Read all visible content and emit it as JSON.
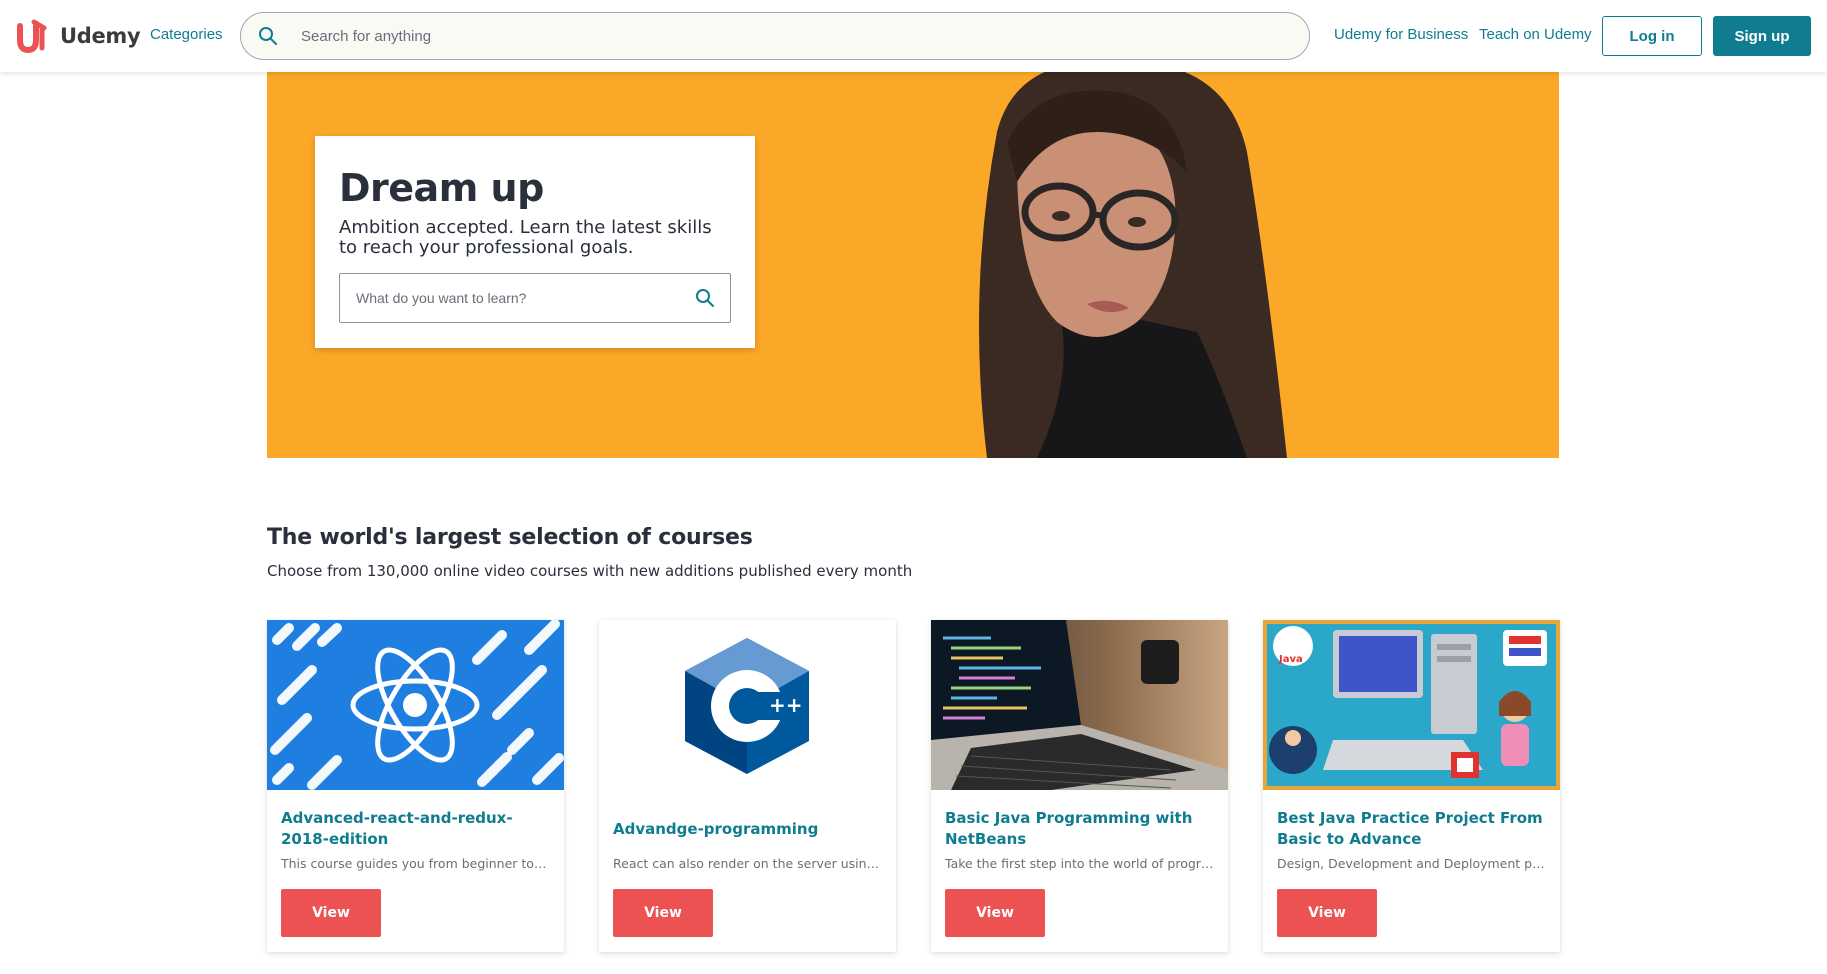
{
  "header": {
    "logo_text": "Udemy",
    "categories_label": "Categories",
    "search_placeholder": "Search for anything",
    "business_label": "Udemy for Business",
    "teach_label": "Teach on Udemy",
    "login_label": "Log in",
    "signup_label": "Sign up"
  },
  "hero": {
    "title": "Dream up",
    "subtitle": "Ambition accepted. Learn the latest skills to reach your professional goals.",
    "search_placeholder": "What do you want to learn?",
    "background_color": "#fba728"
  },
  "section": {
    "title": "The world's largest selection of courses",
    "subtitle": "Choose from 130,000 online video courses with new additions published every month"
  },
  "courses": [
    {
      "title": "Advanced-react-and-redux-2018-edition",
      "description": "This course guides you from beginner to …",
      "button_label": "View",
      "image": "react-logo-thumbnail"
    },
    {
      "title": "Advandge-programming",
      "description": "React can also render on the server using …",
      "button_label": "View",
      "image": "cpp-logo-thumbnail"
    },
    {
      "title": "Basic Java Programming with NetBeans",
      "description": "Take the first step into the world of progr…",
      "button_label": "View",
      "image": "laptop-code-thumbnail"
    },
    {
      "title": "Best Java Practice Project From Basic to Advance",
      "description": "Design, Development and Deployment pr…",
      "button_label": "View",
      "image": "java-cartoon-thumbnail"
    }
  ],
  "colors": {
    "brand_teal": "#0f7c90",
    "brand_red": "#ec5252",
    "hero_orange": "#fba728",
    "text_dark": "#29303b"
  }
}
